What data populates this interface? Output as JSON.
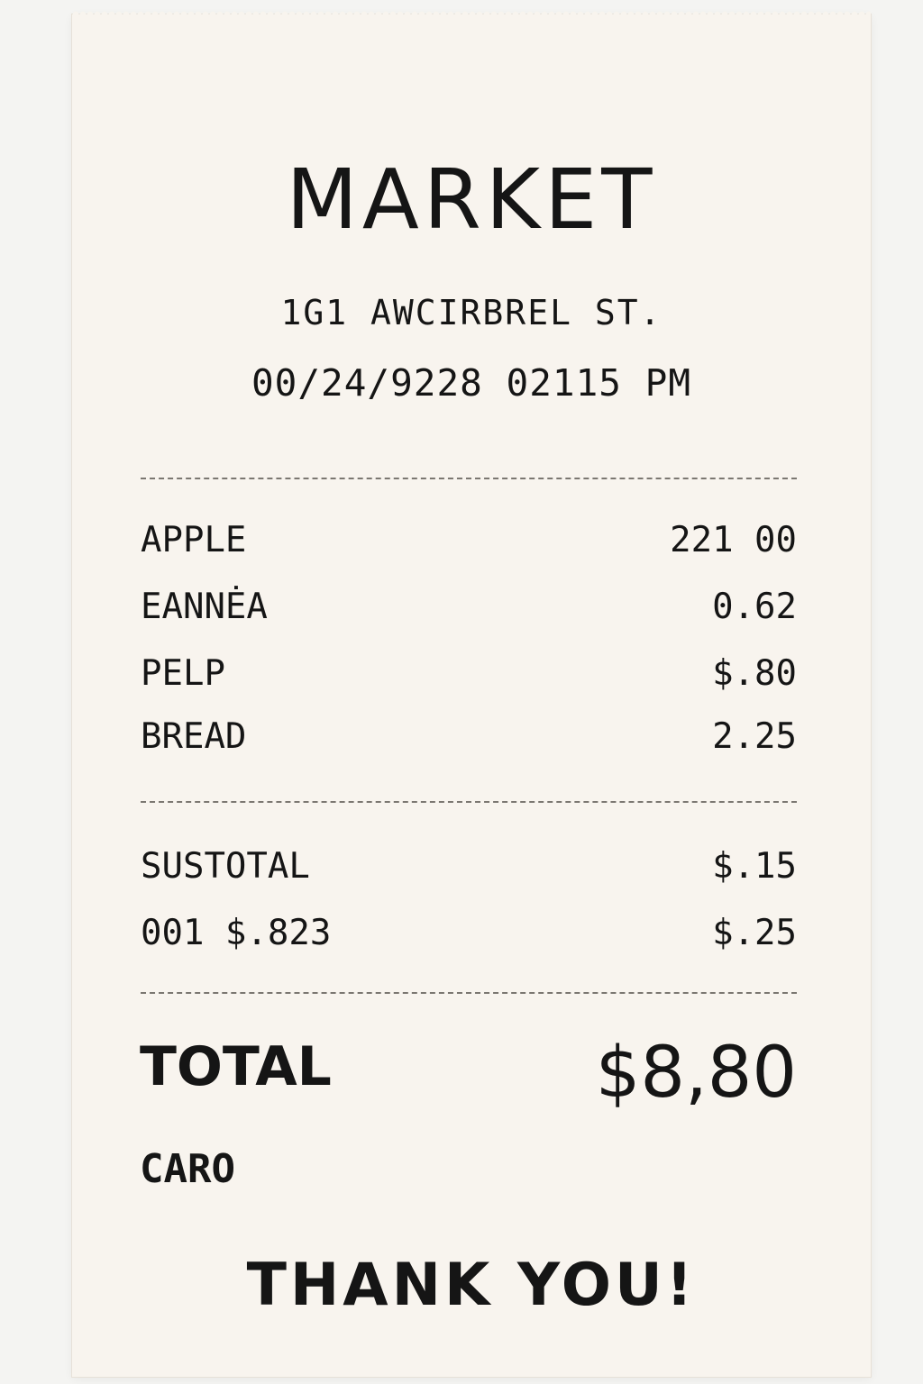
{
  "receipt": {
    "store_name": "MARKET",
    "address": "1G1 AWCIRBREL ST.",
    "datetime": "00/24/9228 02115 PM",
    "items": [
      {
        "name": "APPLE",
        "price": "221 00"
      },
      {
        "name": "EANNĖA",
        "price": "0.62"
      },
      {
        "name": "PELP",
        "price": "$.80"
      },
      {
        "name": "BREAD",
        "price": "2.25"
      }
    ],
    "summary": [
      {
        "label": "SUSTOTAL",
        "value": "$.15"
      },
      {
        "label": "001 $.823",
        "value": "$.25"
      }
    ],
    "total_label": "TOTAL",
    "total_value": "$8,80",
    "payment_method": "CARO",
    "footer": "THANK YOU!"
  }
}
